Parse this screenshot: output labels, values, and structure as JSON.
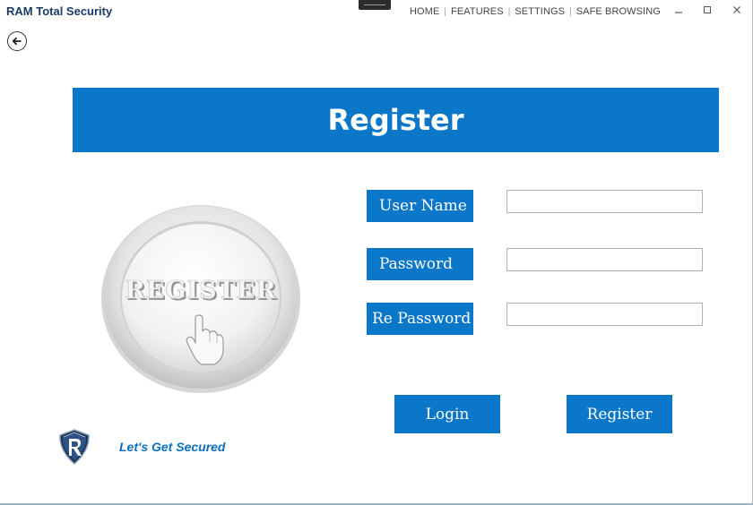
{
  "window": {
    "title": "RAM Total Security"
  },
  "nav": {
    "items": [
      {
        "label": "HOME"
      },
      {
        "label": "FEATURES"
      },
      {
        "label": "SETTINGS"
      },
      {
        "label": "SAFE BROWSING"
      }
    ],
    "separator": "|"
  },
  "window_controls": {
    "minimize": "—",
    "maximize": "☐",
    "close": "✕"
  },
  "banner": {
    "title": "Register"
  },
  "badge": {
    "text": "REGISTER",
    "icon": "hand-pointer-icon"
  },
  "form": {
    "fields": [
      {
        "label": "User Name",
        "value": "",
        "placeholder": ""
      },
      {
        "label": "Password",
        "value": "",
        "placeholder": ""
      },
      {
        "label": "Re Password",
        "value": "",
        "placeholder": ""
      }
    ]
  },
  "actions": {
    "login_label": "Login",
    "register_label": "Register"
  },
  "footer": {
    "tagline": "Let's Get Secured",
    "logo_icon": "shield-r-logo"
  },
  "colors": {
    "accent": "#0a77c9",
    "title_text": "#1a3b66",
    "tagline": "#0a6fbd"
  }
}
